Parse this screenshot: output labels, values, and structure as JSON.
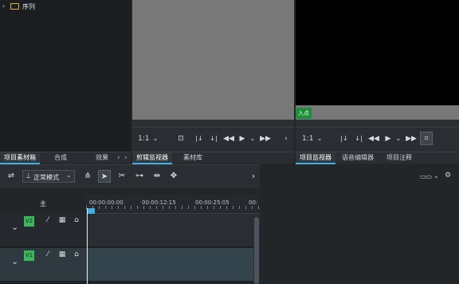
{
  "project_bin": {
    "tree_item": "序列",
    "tabs": [
      "项目素材箱",
      "合成",
      "效果"
    ]
  },
  "clip_monitor": {
    "zoom": "1:1",
    "tabs": [
      "剪辑监视器",
      "素材库"
    ]
  },
  "project_monitor": {
    "zoom": "1:1",
    "in_point_label": "入点",
    "tabs": [
      "项目监视器",
      "语音编辑器",
      "项目注释"
    ]
  },
  "timeline": {
    "mode_label": "正常模式",
    "master_label": "主",
    "ruler": [
      "00:00:00:00",
      "00:00:12:15",
      "00:00:25:05",
      "00:"
    ],
    "tracks": [
      {
        "name": "V2",
        "color": "#3ab75f"
      },
      {
        "name": "V1",
        "color": "#3ab75f"
      }
    ]
  },
  "colors": {
    "accent": "#3daee9",
    "in_point": "#1f8f3a",
    "track_badge": "#3ab75f"
  }
}
